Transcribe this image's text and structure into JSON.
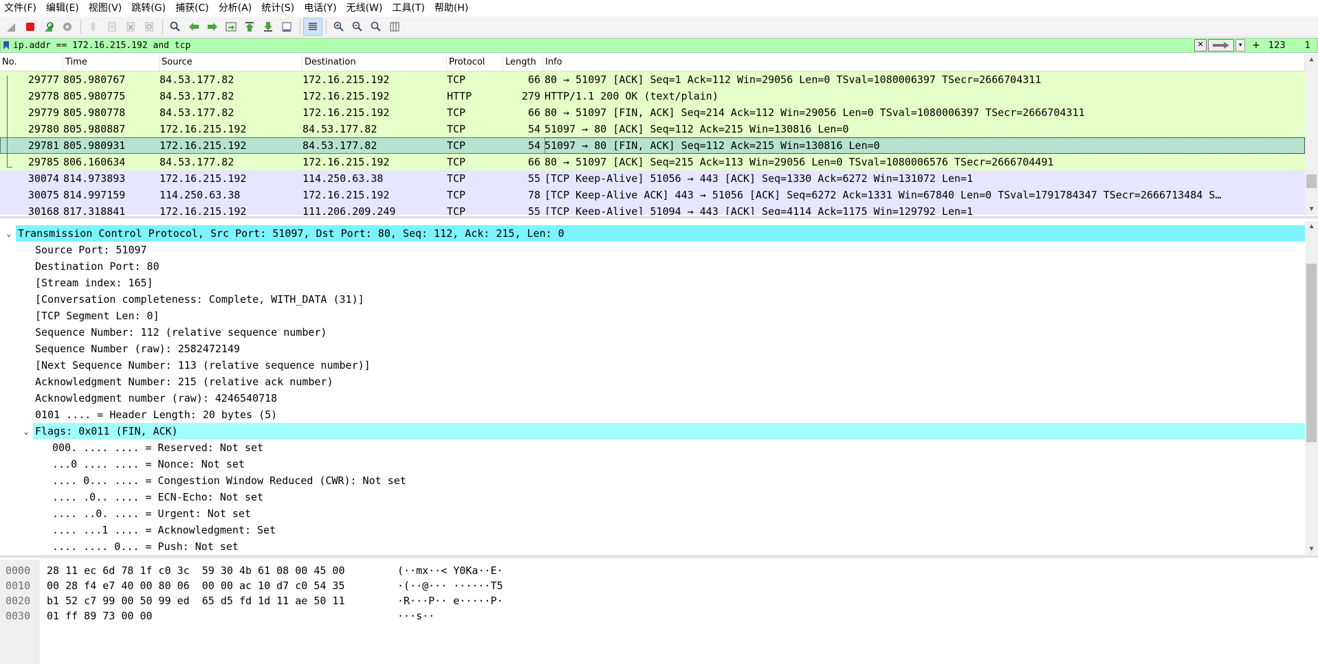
{
  "menu": [
    "文件(F)",
    "编辑(E)",
    "视图(V)",
    "跳转(G)",
    "捕获(C)",
    "分析(A)",
    "统计(S)",
    "电话(Y)",
    "无线(W)",
    "工具(T)",
    "帮助(H)"
  ],
  "toolbar": {
    "icons": [
      "shark-fin-start-icon",
      "stop-capture-icon",
      "restart-capture-icon",
      "capture-options-icon",
      "open-file-icon",
      "save-file-icon",
      "close-file-icon",
      "reload-file-icon",
      "find-packet-icon",
      "go-back-icon",
      "go-forward-icon",
      "go-to-packet-icon",
      "go-first-icon",
      "go-last-icon",
      "auto-scroll-icon",
      "colorize-icon",
      "zoom-in-icon",
      "zoom-out-icon",
      "normal-size-icon",
      "resize-columns-icon"
    ]
  },
  "filter": {
    "value": "ip.addr == 172.16.215.192 and tcp",
    "extra": "+",
    "displayed_count": "123",
    "count2": "1"
  },
  "colors": {
    "http_row": "#e4ffc7",
    "tcp_row_lavender": "#e7e6ff",
    "selected_row": "#b6e2cf",
    "filter_ok": "#afffaf",
    "detail_highlight": "#a0ffff"
  },
  "packet_list": {
    "columns": [
      "No.",
      "Time",
      "Source",
      "Destination",
      "Protocol",
      "Length",
      "Info"
    ],
    "rows": [
      {
        "no": "29777",
        "time": "805.980767",
        "src": "84.53.177.82",
        "dst": "172.16.215.192",
        "proto": "TCP",
        "len": "66",
        "info": "80 → 51097 [ACK] Seq=1 Ack=112 Win=29056 Len=0 TSval=1080006397 TSecr=2666704311",
        "color": "green"
      },
      {
        "no": "29778",
        "time": "805.980775",
        "src": "84.53.177.82",
        "dst": "172.16.215.192",
        "proto": "HTTP",
        "len": "279",
        "info": "HTTP/1.1 200 OK  (text/plain)",
        "color": "green"
      },
      {
        "no": "29779",
        "time": "805.980778",
        "src": "84.53.177.82",
        "dst": "172.16.215.192",
        "proto": "TCP",
        "len": "66",
        "info": "80 → 51097 [FIN, ACK] Seq=214 Ack=112 Win=29056 Len=0 TSval=1080006397 TSecr=2666704311",
        "color": "green"
      },
      {
        "no": "29780",
        "time": "805.980887",
        "src": "172.16.215.192",
        "dst": "84.53.177.82",
        "proto": "TCP",
        "len": "54",
        "info": "51097 → 80 [ACK] Seq=112 Ack=215 Win=130816 Len=0",
        "color": "green"
      },
      {
        "no": "29781",
        "time": "805.980931",
        "src": "172.16.215.192",
        "dst": "84.53.177.82",
        "proto": "TCP",
        "len": "54",
        "info": "51097 → 80 [FIN, ACK] Seq=112 Ack=215 Win=130816 Len=0",
        "color": "selected"
      },
      {
        "no": "29785",
        "time": "806.160634",
        "src": "84.53.177.82",
        "dst": "172.16.215.192",
        "proto": "TCP",
        "len": "66",
        "info": "80 → 51097 [ACK] Seq=215 Ack=113 Win=29056 Len=0 TSval=1080006576 TSecr=2666704491",
        "color": "green"
      },
      {
        "no": "30074",
        "time": "814.973893",
        "src": "172.16.215.192",
        "dst": "114.250.63.38",
        "proto": "TCP",
        "len": "55",
        "info": "[TCP Keep-Alive] 51056 → 443 [ACK] Seq=1330 Ack=6272 Win=131072 Len=1",
        "color": "lavender"
      },
      {
        "no": "30075",
        "time": "814.997159",
        "src": "114.250.63.38",
        "dst": "172.16.215.192",
        "proto": "TCP",
        "len": "78",
        "info": "[TCP Keep-Alive ACK] 443 → 51056 [ACK] Seq=6272 Ack=1331 Win=67840 Len=0 TSval=1791784347 TSecr=2666713484 S…",
        "color": "lavender"
      },
      {
        "no": "30168",
        "time": "817.318841",
        "src": "172.16.215.192",
        "dst": "111.206.209.249",
        "proto": "TCP",
        "len": "55",
        "info": "[TCP Keep-Alive] 51094 → 443 [ACK] Seq=4114 Ack=1175 Win=129792 Len=1",
        "color": "lavender"
      }
    ]
  },
  "details": [
    {
      "text": "Transmission Control Protocol, Src Port: 51097, Dst Port: 80, Seq: 112, Ack: 215, Len: 0",
      "level": 0,
      "twisty": "expanded",
      "hl": "top"
    },
    {
      "text": "Source Port: 51097",
      "level": 1
    },
    {
      "text": "Destination Port: 80",
      "level": 1
    },
    {
      "text": "[Stream index: 165]",
      "level": 1
    },
    {
      "text": "[Conversation completeness: Complete, WITH_DATA (31)]",
      "level": 1
    },
    {
      "text": "[TCP Segment Len: 0]",
      "level": 1
    },
    {
      "text": "Sequence Number: 112    (relative sequence number)",
      "level": 1
    },
    {
      "text": "Sequence Number (raw): 2582472149",
      "level": 1
    },
    {
      "text": "[Next Sequence Number: 113    (relative sequence number)]",
      "level": 1
    },
    {
      "text": "Acknowledgment Number: 215    (relative ack number)",
      "level": 1
    },
    {
      "text": "Acknowledgment number (raw): 4246540718",
      "level": 1
    },
    {
      "text": "0101 .... = Header Length: 20 bytes (5)",
      "level": 1
    },
    {
      "text": "Flags: 0x011 (FIN, ACK)",
      "level": 1,
      "twisty": "expanded",
      "hl": "sub"
    },
    {
      "text": "000. .... .... = Reserved: Not set",
      "level": 2
    },
    {
      "text": "...0 .... .... = Nonce: Not set",
      "level": 2
    },
    {
      "text": ".... 0... .... = Congestion Window Reduced (CWR): Not set",
      "level": 2
    },
    {
      "text": ".... .0.. .... = ECN-Echo: Not set",
      "level": 2
    },
    {
      "text": ".... ..0. .... = Urgent: Not set",
      "level": 2
    },
    {
      "text": ".... ...1 .... = Acknowledgment: Set",
      "level": 2
    },
    {
      "text": ".... .... 0... = Push: Not set",
      "level": 2
    }
  ],
  "bytes": [
    {
      "offset": "0000",
      "hex": "28 11 ec 6d 78 1f c0 3c  59 30 4b 61 08 00 45 00",
      "ascii": "(··mx··< Y0Ka··E·"
    },
    {
      "offset": "0010",
      "hex": "00 28 f4 e7 40 00 80 06  00 00 ac 10 d7 c0 54 35",
      "ascii": "·(··@··· ······T5"
    },
    {
      "offset": "0020",
      "hex": "b1 52 c7 99 00 50 99 ed  65 d5 fd 1d 11 ae 50 11",
      "ascii": "·R···P·· e·····P·"
    },
    {
      "offset": "0030",
      "hex": "01 ff 89 73 00 00",
      "ascii": "···s··"
    }
  ]
}
